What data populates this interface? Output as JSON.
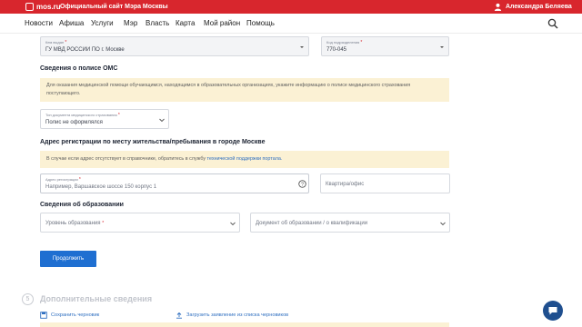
{
  "header": {
    "site": "mos.ru",
    "slogan": "Официальный сайт Мэра Москвы",
    "user_name": "Александра Беляева",
    "accent_color": "#d8262d"
  },
  "nav": {
    "items": [
      "Новости",
      "Афиша",
      "Услуги",
      "Мэр",
      "Власть",
      "Карта",
      "Мой район",
      "Помощь"
    ],
    "search_icon": "search-icon"
  },
  "passport": {
    "issuer_label": "Кем выдан",
    "issuer_value": "ГУ МВД РОССИИ ПО г. Москве",
    "code_label": "Код подразделения",
    "code_value": "770-045"
  },
  "oms": {
    "title": "Сведения о полисе ОМС",
    "notice": "Для оказания медицинской помощи обучающимся, находящимся в образовательных организациях, укажите информацию о полисе медицинского страхования поступающего.",
    "doc_type_label": "Тип документа медицинского страхования",
    "doc_type_value": "Полис не оформлялся"
  },
  "address": {
    "title": "Адрес регистрации по месту жительства/пребывания в городе Москве",
    "notice_text": "В случае если адрес отсутствует в справочнике, обратитесь в службу",
    "notice_link": "технической поддержки портала.",
    "field_label": "Адрес регистрации",
    "field_placeholder": "Например, Варшавское шоссе 150 корпус 1",
    "apartment_placeholder": "Квартира/офис"
  },
  "education": {
    "title": "Сведения об образовании",
    "level_placeholder": "Уровень образования",
    "doc_placeholder": "Документ об образовании / о квалификации"
  },
  "actions": {
    "continue_label": "Продолжить",
    "button_color": "#1f6fd1"
  },
  "next_step": {
    "number": "5",
    "title": "Дополнительные сведения"
  },
  "footer_links": {
    "save_draft": "Сохранить черновик",
    "load_draft": "Загрузить заявление из списка черновиков"
  }
}
